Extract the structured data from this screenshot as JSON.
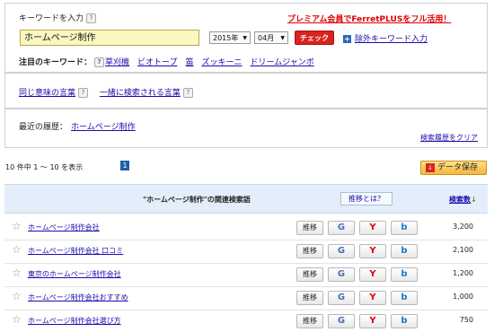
{
  "search": {
    "label": "キーワードを入力",
    "help": "?",
    "premium_notice": "プレミアム会員でFerretPLUSをフル活用！",
    "input_value": "ホームページ制作",
    "year_value": "2015年",
    "month_value": "04月",
    "check_label": "チェック",
    "exclude_plus": "+",
    "exclude_label": "除外キーワード入力"
  },
  "featured": {
    "label": "注目のキーワード：",
    "help": "?",
    "items": [
      "草刈機",
      "ビオトープ",
      "笛",
      "ズッキーニ",
      "ドリームジャンボ"
    ]
  },
  "related_links": {
    "synonyms": "同じ意味の言葉",
    "co_searched": "一緒に検索される言葉",
    "help": "?"
  },
  "history": {
    "label": "最近の履歴：",
    "item": "ホームページ制作",
    "clear": "検索履歴をクリア"
  },
  "results": {
    "summary": "10 件中 1 〜 10 を表示",
    "page": "1",
    "save_label": "データ保存",
    "header_title": "\"ホームページ制作\"の関連検索語",
    "trend_help": "推移とは？",
    "count_header": "検索数",
    "count_sort_icon": "↓"
  },
  "rows": [
    {
      "star": "☆",
      "keyword": "ホームページ制作会社",
      "trend": "推移",
      "google": "G",
      "yahoo": "Y",
      "bing": "b",
      "count": "3,200"
    },
    {
      "star": "☆",
      "keyword": "ホームページ制作会社 口コミ",
      "trend": "推移",
      "google": "G",
      "yahoo": "Y",
      "bing": "b",
      "count": "2,100"
    },
    {
      "star": "☆",
      "keyword": "東京のホームページ制作会社",
      "trend": "推移",
      "google": "G",
      "yahoo": "Y",
      "bing": "b",
      "count": "1,200"
    },
    {
      "star": "☆",
      "keyword": "ホームページ制作会社おすすめ",
      "trend": "推移",
      "google": "G",
      "yahoo": "Y",
      "bing": "b",
      "count": "1,000"
    },
    {
      "star": "☆",
      "keyword": "ホームページ制作会社選び方",
      "trend": "推移",
      "google": "G",
      "yahoo": "Y",
      "bing": "b",
      "count": "750"
    }
  ],
  "colors": {
    "premium_red": "#e00000",
    "check_red": "#d8231f",
    "link_blue": "#1a0dab",
    "header_bg": "#e3eefa",
    "input_yellow": "#fbf7c2",
    "yahoo_red": "#e60012",
    "bing_blue": "#1a7bc9",
    "save_orange": "#f6b73c"
  }
}
